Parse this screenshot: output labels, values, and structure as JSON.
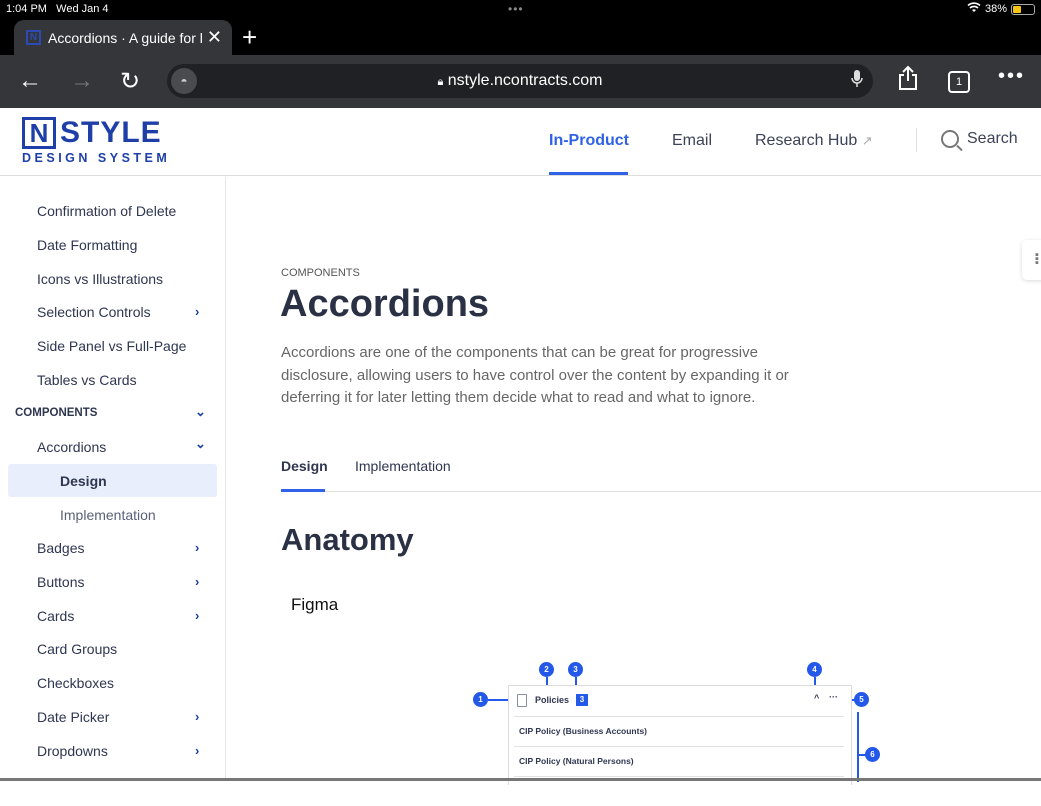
{
  "status_bar": {
    "time": "1:04 PM",
    "date": "Wed Jan 4",
    "center_dots": "•••",
    "battery_percent": "38%",
    "battery_level": 0.38,
    "wifi_icon": "wifi-icon"
  },
  "browser": {
    "tab_title": "Accordions · A guide for l",
    "tab_favicon": "N",
    "url": "nstyle.ncontracts.com",
    "tab_count": "1"
  },
  "header": {
    "logo_mark": "N",
    "logo_word": "STYLE",
    "logo_sub": "DESIGN SYSTEM",
    "nav": [
      {
        "label": "In-Product",
        "active": true
      },
      {
        "label": "Email",
        "active": false
      },
      {
        "label": "Research Hub",
        "active": false,
        "external": true
      }
    ],
    "search_label": "Search"
  },
  "sidebar": {
    "items_top": [
      {
        "label": "Confirmation of Delete",
        "has_children": false
      },
      {
        "label": "Date Formatting",
        "has_children": false
      },
      {
        "label": "Icons vs Illustrations",
        "has_children": false
      },
      {
        "label": "Selection Controls",
        "has_children": true
      },
      {
        "label": "Side Panel vs Full-Page",
        "has_children": false
      },
      {
        "label": "Tables vs Cards",
        "has_children": false
      }
    ],
    "section": "COMPONENTS",
    "current_group": "Accordions",
    "current_subitems": [
      {
        "label": "Design",
        "active": true
      },
      {
        "label": "Implementation",
        "active": false
      }
    ],
    "items_bottom": [
      {
        "label": "Badges",
        "has_children": true
      },
      {
        "label": "Buttons",
        "has_children": true
      },
      {
        "label": "Cards",
        "has_children": true
      },
      {
        "label": "Card Groups",
        "has_children": false
      },
      {
        "label": "Checkboxes",
        "has_children": false
      },
      {
        "label": "Date Picker",
        "has_children": true
      },
      {
        "label": "Dropdowns",
        "has_children": true
      }
    ]
  },
  "main": {
    "eyebrow": "COMPONENTS",
    "title": "Accordions",
    "description": "Accordions are one of the components that can be great for progressive disclosure, allowing users to have control over the content by expanding it or deferring it for later letting them decide what to read and what to ignore.",
    "tabs": [
      {
        "label": "Design",
        "active": true
      },
      {
        "label": "Implementation",
        "active": false
      }
    ],
    "section_title": "Anatomy",
    "figma_label": "Figma",
    "diagram": {
      "pins": [
        "1",
        "2",
        "3",
        "4",
        "5",
        "6"
      ],
      "accordion_title": "Policies",
      "accordion_count": "3",
      "caret": "^",
      "more": "···",
      "rows": [
        "CIP Policy (Business Accounts)",
        "CIP Policy (Natural Persons)"
      ]
    }
  },
  "colors": {
    "brand": "#1f3fa8",
    "accent": "#2f62e6",
    "pin": "#2458e8",
    "text": "#2e3650"
  }
}
